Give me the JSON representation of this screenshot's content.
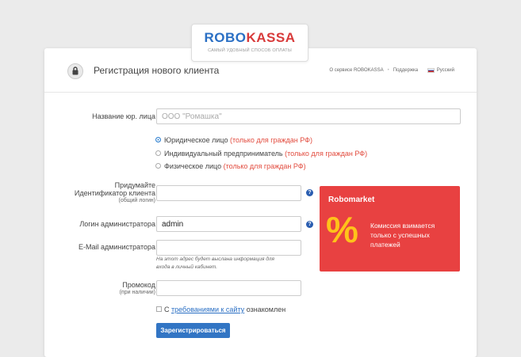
{
  "brand": {
    "name_part1": "ROBO",
    "name_part2": "KASSA",
    "tagline": "САМЫЙ УДОБНЫЙ СПОСОБ ОПЛАТЫ",
    "colors": {
      "primary": "#2a6fc4",
      "accent": "#d83a3a"
    }
  },
  "header": {
    "title": "Регистрация нового клиента",
    "links": {
      "about": "О сервисе ROBOKASSA",
      "support": "Поддержка",
      "language": "Русский"
    }
  },
  "form": {
    "company_name": {
      "label": "Название юр. лица",
      "placeholder": "ООО \"Ромашка\"",
      "value": ""
    },
    "entity_type": {
      "options": [
        {
          "label": "Юридическое лицо",
          "note": "(только для граждан РФ)",
          "selected": true
        },
        {
          "label": "Индивидуальный предприниматель",
          "note": "(только для граждан РФ)",
          "selected": false
        },
        {
          "label": "Физическое лицо",
          "note": "(только для граждан РФ)",
          "selected": false
        }
      ]
    },
    "identifier": {
      "label_line1": "Придумайте",
      "label_line2": "Идентификатор клиента",
      "label_sub": "(общий логин)",
      "value": ""
    },
    "admin_login": {
      "label": "Логин администратора",
      "value": "admin"
    },
    "admin_email": {
      "label": "E-Mail администратора",
      "value": "",
      "note_line1": "На этот адрес будет выслана информация для",
      "note_line2": "входа в личный кабинет."
    },
    "promo_code": {
      "label": "Промокод",
      "label_sub": "(при наличии)",
      "value": ""
    },
    "agreement": {
      "prefix": "С",
      "link": "требованиями к сайту",
      "suffix": "ознакомлен",
      "checked": false
    },
    "submit_label": "Зарегистрироваться",
    "hint_icon": "question-icon"
  },
  "promo": {
    "title": "Robomarket",
    "symbol": "%",
    "text": "Комиссия взимается только с успешных платежей",
    "colors": {
      "background": "#e84141",
      "symbol": "#ffc21a"
    }
  }
}
